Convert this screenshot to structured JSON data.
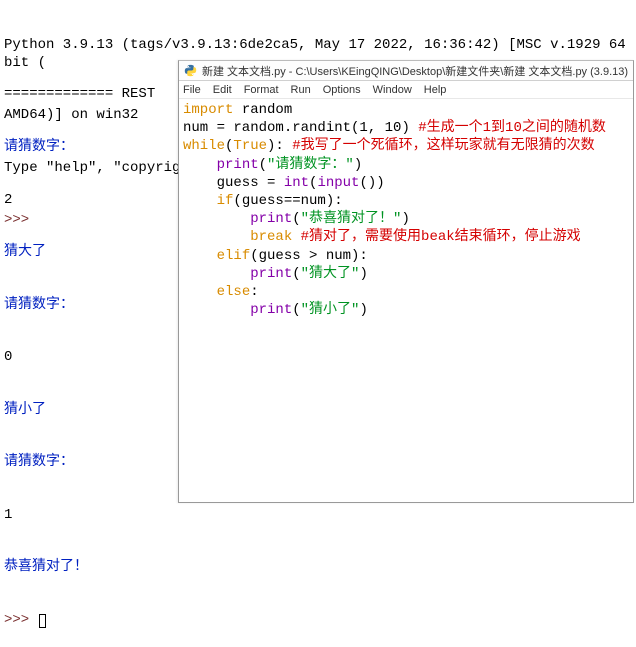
{
  "shell": {
    "banner1": "Python 3.9.13 (tags/v3.9.13:6de2ca5, May 17 2022, 16:36:42) [MSC v.1929 64 bit (",
    "banner2": "AMD64)] on win32",
    "helpline": "Type \"help\", \"copyright\", \"credits\" or \"license()\" for more information.",
    "prompt": ">>>",
    "restart": "============= REST"
  },
  "session": {
    "l1": "请猜数字：",
    "l2": "2",
    "l3": "猜大了",
    "l4": "请猜数字：",
    "l5": "0",
    "l6": "猜小了",
    "l7": "请猜数字：",
    "l8": "1",
    "l9": "恭喜猜对了！",
    "prompt": ">>>"
  },
  "editor": {
    "title": "新建 文本文档.py - C:\\Users\\KEingQING\\Desktop\\新建文件夹\\新建 文本文档.py (3.9.13)",
    "menu": [
      "File",
      "Edit",
      "Format",
      "Run",
      "Options",
      "Window",
      "Help"
    ]
  },
  "code": {
    "kw_import": "import",
    "mod_random": " random",
    "l2a": "num = random.",
    "l2b": "randint",
    "l2c": "(1, 10) ",
    "c1": "#生成一个1到10之间的随机数",
    "l3a": "while",
    "l3b": "(",
    "l3c": "True",
    "l3d": "): ",
    "c2": "#我写了一个死循环，这样玩家就有无限猜的次数",
    "l4a": "    ",
    "l4b": "print",
    "l4c": "(",
    "s1": "\"请猜数字：\"",
    "l4d": ")",
    "l5a": "    guess = ",
    "l5b": "int",
    "l5c": "(",
    "l5d": "input",
    "l5e": "())",
    "l6a": "    ",
    "l6b": "if",
    "l6c": "(guess==num):",
    "l7a": "        ",
    "l7b": "print",
    "l7c": "(",
    "s2": "\"恭喜猜对了！\"",
    "l7d": ")",
    "l8a": "        ",
    "l8b": "break",
    "l8c": " ",
    "c3": "#猜对了，需要使用beak结束循环，停止游戏",
    "l9a": "    ",
    "l9b": "elif",
    "l9c": "(guess > num):",
    "l10a": "        ",
    "l10b": "print",
    "l10c": "(",
    "s3": "\"猜大了\"",
    "l10d": ")",
    "l11a": "    ",
    "l11b": "else",
    "l11c": ":",
    "l12a": "        ",
    "l12b": "print",
    "l12c": "(",
    "s4": "\"猜小了\"",
    "l12d": ")"
  }
}
